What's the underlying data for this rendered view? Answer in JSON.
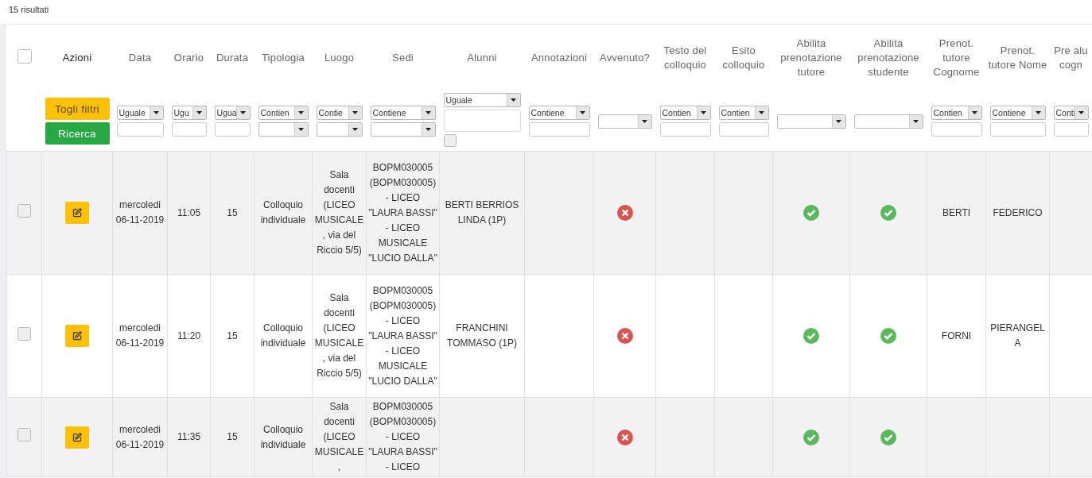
{
  "results_count": "15 risultati",
  "table": {
    "select_all": {
      "checked": false
    },
    "columns": [
      {
        "label": "Azioni",
        "sortable": false,
        "filter": {
          "kind": "buttons",
          "buttons": [
            {
              "label": "Togli filtri",
              "kind": "warning"
            },
            {
              "label": "Ricerca",
              "kind": "success"
            }
          ]
        }
      },
      {
        "label": "Data",
        "sortable": true,
        "filter": {
          "kind": "text",
          "operator": "Uguale"
        }
      },
      {
        "label": "Orario",
        "sortable": true,
        "filter": {
          "kind": "text",
          "operator": "Ugu"
        }
      },
      {
        "label": "Durata",
        "sortable": true,
        "filter": {
          "kind": "text",
          "operator": "Ugua"
        }
      },
      {
        "label": "Tipologia",
        "sortable": true,
        "filter": {
          "kind": "choice",
          "operator": "Contien"
        }
      },
      {
        "label": "Luogo",
        "sortable": true,
        "filter": {
          "kind": "choice",
          "operator": "Contie"
        }
      },
      {
        "label": "Sedi",
        "sortable": true,
        "filter": {
          "kind": "choice",
          "operator": "Contiene"
        }
      },
      {
        "label": "Alunni",
        "sortable": true,
        "filter": {
          "kind": "multi",
          "operator": "Uguale",
          "checked": false
        }
      },
      {
        "label": "Annotazioni",
        "sortable": true,
        "filter": {
          "kind": "text",
          "operator": "Contiene"
        }
      },
      {
        "label": "Avvenuto?",
        "sortable": true,
        "filter": {
          "kind": "dropdown"
        }
      },
      {
        "label": "Testo del colloquio",
        "sortable": true,
        "filter": {
          "kind": "text",
          "operator": "Contien"
        }
      },
      {
        "label": "Esito colloquio",
        "sortable": true,
        "filter": {
          "kind": "text",
          "operator": "Contien"
        }
      },
      {
        "label": "Abilita prenotazione tutore",
        "sortable": true,
        "filter": {
          "kind": "dropdown"
        }
      },
      {
        "label": "Abilita prenotazione studente",
        "sortable": true,
        "filter": {
          "kind": "dropdown"
        }
      },
      {
        "label": "Prenot. tutore Cognome",
        "sortable": true,
        "filter": {
          "kind": "text",
          "operator": "Contien"
        }
      },
      {
        "label": "Prenot. tutore Nome",
        "sortable": true,
        "filter": {
          "kind": "text",
          "operator": "Contiene"
        }
      },
      {
        "label": "Pre alu cogn",
        "sortable": true,
        "filter": {
          "kind": "text",
          "operator": "Conti"
        }
      }
    ],
    "rows": [
      {
        "selected": false,
        "cells": [
          {
            "kind": "edit"
          },
          {
            "kind": "text",
            "text": "mercoledi 06-11-2019"
          },
          {
            "kind": "text",
            "text": "11:05"
          },
          {
            "kind": "text",
            "text": "15"
          },
          {
            "kind": "text",
            "text": "Colloquio individuale"
          },
          {
            "kind": "text",
            "text": "Sala docenti (LICEO MUSICALE, via del Riccio 5/5)"
          },
          {
            "kind": "text",
            "text": "BOPM030005 (BOPM030005) - LICEO \"LAURA BASSI\" - LICEO MUSICALE \"LUCIO DALLA\""
          },
          {
            "kind": "text",
            "text": "BERTI BERRIOS LINDA (1P)"
          },
          {
            "kind": "empty"
          },
          {
            "kind": "status",
            "on": false
          },
          {
            "kind": "empty"
          },
          {
            "kind": "empty"
          },
          {
            "kind": "status",
            "on": true
          },
          {
            "kind": "status",
            "on": true
          },
          {
            "kind": "text",
            "text": "BERTI"
          },
          {
            "kind": "text",
            "text": "FEDERICO"
          },
          {
            "kind": "empty"
          }
        ]
      },
      {
        "selected": false,
        "cells": [
          {
            "kind": "edit"
          },
          {
            "kind": "text",
            "text": "mercoledi 06-11-2019"
          },
          {
            "kind": "text",
            "text": "11:20"
          },
          {
            "kind": "text",
            "text": "15"
          },
          {
            "kind": "text",
            "text": "Colloquio individuale"
          },
          {
            "kind": "text",
            "text": "Sala docenti (LICEO MUSICALE, via del Riccio 5/5)"
          },
          {
            "kind": "text",
            "text": "BOPM030005 (BOPM030005) - LICEO \"LAURA BASSI\" - LICEO MUSICALE \"LUCIO DALLA\""
          },
          {
            "kind": "text",
            "text": "FRANCHINI TOMMASO (1P)"
          },
          {
            "kind": "empty"
          },
          {
            "kind": "status",
            "on": false
          },
          {
            "kind": "empty"
          },
          {
            "kind": "empty"
          },
          {
            "kind": "status",
            "on": true
          },
          {
            "kind": "status",
            "on": true
          },
          {
            "kind": "text",
            "text": "FORNI"
          },
          {
            "kind": "text",
            "text": "PIERANGELA"
          },
          {
            "kind": "empty"
          }
        ]
      },
      {
        "selected": false,
        "cells": [
          {
            "kind": "edit"
          },
          {
            "kind": "text",
            "text": "mercoledi 06-11-2019"
          },
          {
            "kind": "text",
            "text": "11:35"
          },
          {
            "kind": "text",
            "text": "15"
          },
          {
            "kind": "text",
            "text": "Colloquio individuale"
          },
          {
            "kind": "text",
            "text": "Sala docenti (LICEO MUSICALE,"
          },
          {
            "kind": "text",
            "text": "BOPM030005 (BOPM030005) - LICEO \"LAURA BASSI\" - LICEO"
          },
          {
            "kind": "empty"
          },
          {
            "kind": "empty"
          },
          {
            "kind": "status",
            "on": false
          },
          {
            "kind": "empty"
          },
          {
            "kind": "empty"
          },
          {
            "kind": "status",
            "on": true
          },
          {
            "kind": "status",
            "on": true
          },
          {
            "kind": "empty"
          },
          {
            "kind": "empty"
          },
          {
            "kind": "empty"
          }
        ]
      }
    ]
  }
}
